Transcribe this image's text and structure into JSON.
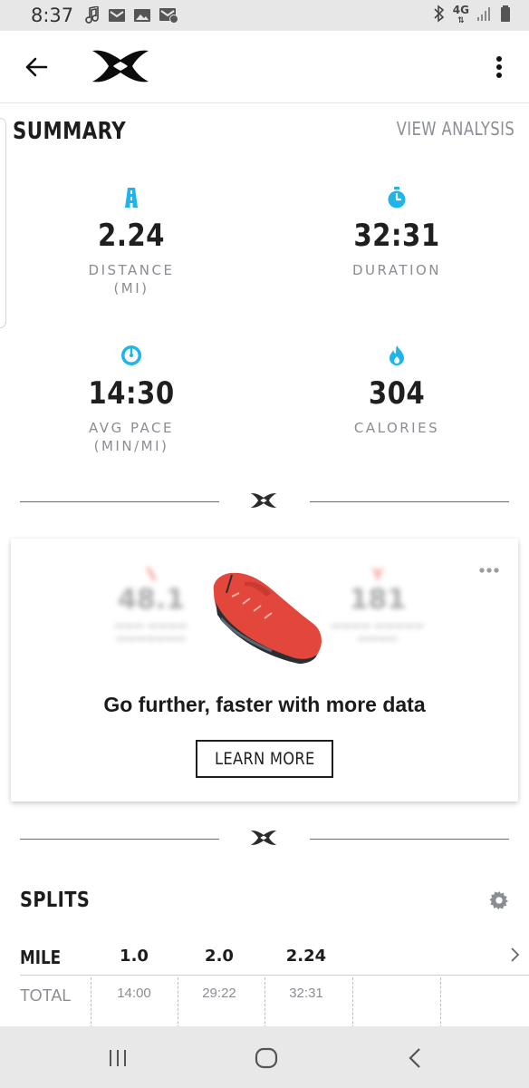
{
  "status_bar": {
    "time": "8:37",
    "network": "4G",
    "icons_left": [
      "music-note-icon",
      "gmail-icon",
      "gallery-icon",
      "mail-check-icon"
    ],
    "icons_right": [
      "bluetooth-icon",
      "network-4g-icon",
      "signal-icon",
      "battery-icon"
    ]
  },
  "app_bar": {
    "back_icon": "arrow-left-icon",
    "logo": "under-armour-logo",
    "menu_icon": "more-vertical-icon"
  },
  "summary": {
    "title": "SUMMARY",
    "view_analysis": "VIEW ANALYSIS",
    "stats": {
      "distance": {
        "icon": "road-icon",
        "value": "2.24",
        "label": "DISTANCE",
        "unit": "(MI)"
      },
      "duration": {
        "icon": "stopwatch-icon",
        "value": "32:31",
        "label": "DURATION"
      },
      "pace": {
        "icon": "speedometer-icon",
        "value": "14:30",
        "label": "AVG PACE",
        "unit": "(MIN/MI)"
      },
      "calories": {
        "icon": "flame-icon",
        "value": "304",
        "label": "CALORIES"
      }
    }
  },
  "promo": {
    "headline": "Go further, faster with more data",
    "cta": "LEARN MORE",
    "blurred_left": "48.1",
    "blurred_right": "181",
    "more_icon": "more-horizontal-icon"
  },
  "splits": {
    "title": "SPLITS",
    "unit_label": "MILE",
    "columns": [
      "1.0",
      "2.0",
      "2.24"
    ],
    "rows": [
      {
        "label": "TOTAL",
        "values": [
          "14:00",
          "29:22",
          "32:31"
        ]
      }
    ]
  },
  "colors": {
    "accent": "#1fb5ea",
    "text_dark": "#1f1f1f",
    "text_muted": "#8a8d92",
    "promo_shoe": "#e3463a"
  },
  "nav_bar": {
    "icons": [
      "recent-apps-icon",
      "home-icon",
      "back-icon"
    ]
  }
}
